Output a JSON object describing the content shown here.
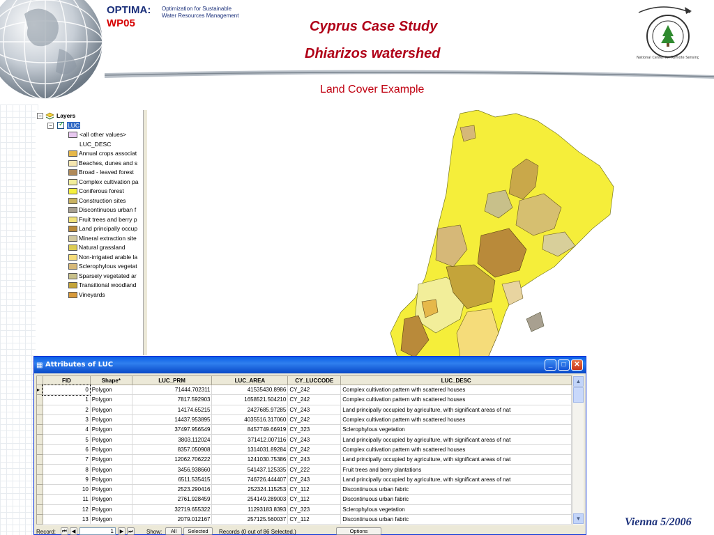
{
  "header": {
    "brand": "OPTIMA:",
    "workpackage": "WP05",
    "tagline_line1": "Optimization for Sustainable",
    "tagline_line2": "Water Resources Management",
    "title_line1": "Cyprus Case Study",
    "title_line2": "Dhiarizos watershed",
    "subtitle": "Land Cover Example",
    "logo_icon": "ncrs-seal-icon",
    "logo_ring_text": "National Center for Remote Sensing"
  },
  "toc": {
    "root_label": "Layers",
    "layer_label": "LUC",
    "other_values": "<all other values>",
    "field_label": "LUC_DESC",
    "legend": [
      {
        "label": "Annual crops associat",
        "color": "#e6b84a"
      },
      {
        "label": "Beaches, dunes and s",
        "color": "#f5e6b0"
      },
      {
        "label": "Broad - leaved forest",
        "color": "#b08a5a"
      },
      {
        "label": "Complex cultivation pa",
        "color": "#f2ee9a"
      },
      {
        "label": "Coniferous forest",
        "color": "#f5f03c"
      },
      {
        "label": "Construction sites",
        "color": "#c9b260"
      },
      {
        "label": "Discontinuous urban f",
        "color": "#a8a090"
      },
      {
        "label": "Fruit trees and berry p",
        "color": "#f2e27a"
      },
      {
        "label": "Land principally occup",
        "color": "#b98a3a"
      },
      {
        "label": "Mineral extraction site",
        "color": "#d2c9a0"
      },
      {
        "label": "Natural grassland",
        "color": "#dccb52"
      },
      {
        "label": "Non-irrigated arable la",
        "color": "#f5dc7a"
      },
      {
        "label": "Sclerophylous vegetat",
        "color": "#d6b878"
      },
      {
        "label": "Sparsely vegetated ar",
        "color": "#c8c08a"
      },
      {
        "label": "Transitional woodland",
        "color": "#c4a43a"
      },
      {
        "label": "Vineyards",
        "color": "#d89a3a"
      }
    ]
  },
  "attributes": {
    "window_title": "Attributes of LUC",
    "columns": [
      "FID",
      "Shape*",
      "LUC_PRM",
      "LUC_AREA",
      "CY_LUCCODE",
      "LUC_DESC"
    ],
    "rows": [
      [
        "0",
        "Polygon",
        "71444.702311",
        "41535430.8986",
        "CY_242",
        "Complex cultivation pattern with scattered houses"
      ],
      [
        "1",
        "Polygon",
        "7817.592903",
        "1658521.504210",
        "CY_242",
        "Complex cultivation pattern with scattered houses"
      ],
      [
        "2",
        "Polygon",
        "14174.65215",
        "2427685.97285",
        "CY_243",
        "Land principally occupied by agriculture, with significant areas of nat"
      ],
      [
        "3",
        "Polygon",
        "14437.953895",
        "4035516.317060",
        "CY_242",
        "Complex cultivation pattern with scattered houses"
      ],
      [
        "4",
        "Polygon",
        "37497.956549",
        "8457749.66919",
        "CY_323",
        "Sclerophylous vegetation"
      ],
      [
        "5",
        "Polygon",
        "3803.112024",
        "371412.007116",
        "CY_243",
        "Land principally occupied by agriculture, with significant areas of nat"
      ],
      [
        "6",
        "Polygon",
        "8357.050908",
        "1314031.89284",
        "CY_242",
        "Complex cultivation pattern with scattered houses"
      ],
      [
        "7",
        "Polygon",
        "12062.706222",
        "1241030.75386",
        "CY_243",
        "Land principally occupied by agriculture, with significant areas of nat"
      ],
      [
        "8",
        "Polygon",
        "3456.938660",
        "541437.125335",
        "CY_222",
        "Fruit trees and berry plantations"
      ],
      [
        "9",
        "Polygon",
        "6511.535415",
        "746726.444407",
        "CY_243",
        "Land principally occupied by agriculture, with significant areas of nat"
      ],
      [
        "10",
        "Polygon",
        "2523.290416",
        "252324.115253",
        "CY_112",
        "Discontinuous urban fabric"
      ],
      [
        "11",
        "Polygon",
        "2761.928459",
        "254149.289003",
        "CY_112",
        "Discontinuous urban fabric"
      ],
      [
        "12",
        "Polygon",
        "32719.655322",
        "11293183.8393",
        "CY_323",
        "Sclerophylous vegetation"
      ],
      [
        "13",
        "Polygon",
        "2079.012167",
        "257125.560037",
        "CY_112",
        "Discontinuous urban fabric"
      ]
    ],
    "status": {
      "record_label": "Record:",
      "record_value": "1",
      "show_label": "Show:",
      "show_all": "All",
      "show_selected": "Selected",
      "records_text": "Records (0 out of 86 Selected.)",
      "options_label": "Options"
    }
  },
  "footer": {
    "date": "Vienna 5/2006"
  }
}
